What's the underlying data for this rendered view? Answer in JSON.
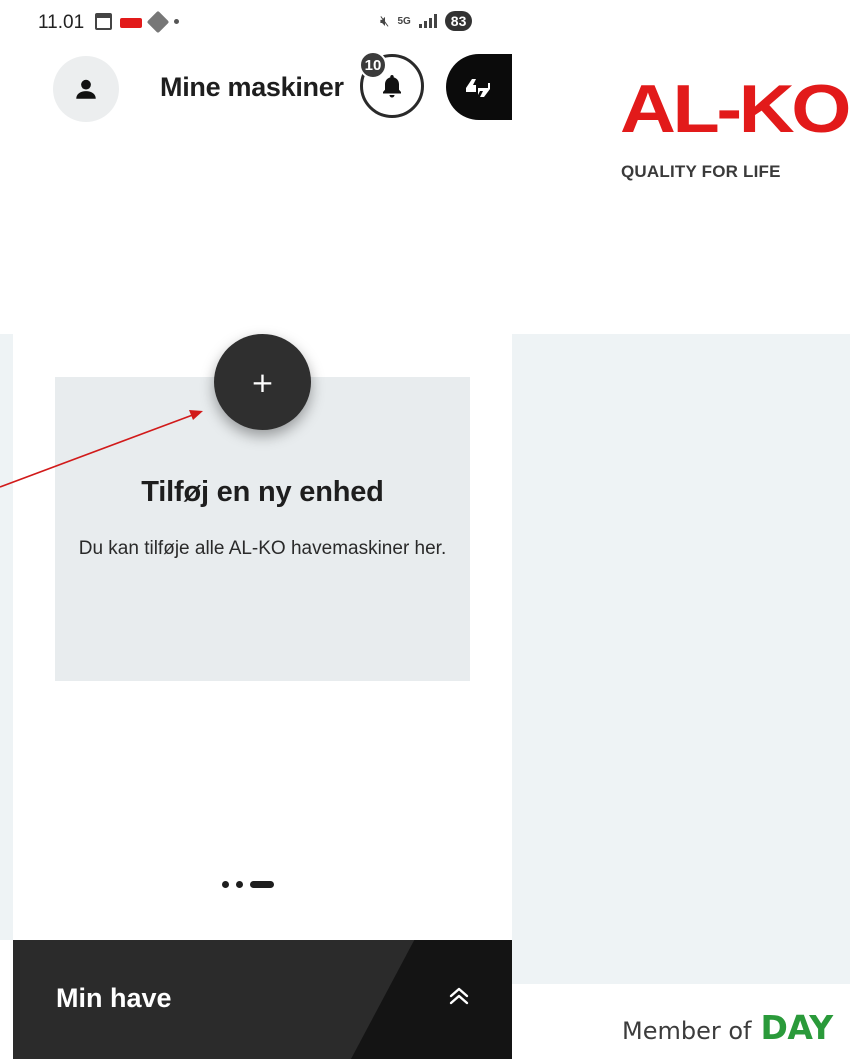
{
  "statusbar": {
    "time": "11.01",
    "network_5g": "5G",
    "battery": "83"
  },
  "header": {
    "title": "Mine maskiner",
    "notification_count": "10"
  },
  "card": {
    "add_label": "+",
    "title": "Tilføj en ny enhed",
    "description": "Du kan tilføje alle AL-KO havemaskiner her."
  },
  "pager": {
    "pages": 3,
    "active": 3
  },
  "bottom_bar": {
    "title": "Min have"
  },
  "brand": {
    "logo_text": "AL-KO",
    "tagline": "QUALITY FOR LIFE",
    "member_text": "Member of",
    "member_brand": "DAY"
  },
  "colors": {
    "brand_red": "#e21a1a",
    "card_bg": "#e8ecee",
    "panel_bg": "#eef3f5",
    "bottom_bar": "#2b2b2b",
    "member_green": "#2a9a3a",
    "annotation_arrow": "#d11a1a"
  },
  "icons": {
    "avatar": "person-icon",
    "notifications": "bell-icon",
    "feedback": "quote-icon",
    "expand": "double-chevron-up-icon"
  }
}
